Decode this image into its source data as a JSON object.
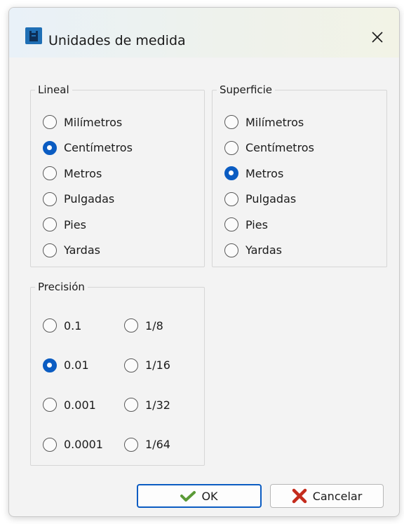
{
  "window": {
    "title": "Unidades de medida"
  },
  "icons": {
    "app": "app-icon",
    "close": "close-icon",
    "ok": "check-icon",
    "cancel": "x-icon"
  },
  "colors": {
    "accent": "#0b5cc2",
    "ok_check": "#5b9a37",
    "cancel_x": "#c42b1c"
  },
  "lineal": {
    "legend": "Lineal",
    "options": [
      "Milímetros",
      "Centímetros",
      "Metros",
      "Pulgadas",
      "Pies",
      "Yardas"
    ],
    "selected": "Centímetros"
  },
  "superficie": {
    "legend": "Superficie",
    "options": [
      "Milímetros",
      "Centímetros",
      "Metros",
      "Pulgadas",
      "Pies",
      "Yardas"
    ],
    "selected": "Metros"
  },
  "precision": {
    "legend": "Precisión",
    "decimal": [
      "0.1",
      "0.01",
      "0.001",
      "0.0001"
    ],
    "fraction": [
      "1/8",
      "1/16",
      "1/32",
      "1/64"
    ],
    "selected": "0.01"
  },
  "buttons": {
    "ok": "OK",
    "cancel": "Cancelar"
  }
}
